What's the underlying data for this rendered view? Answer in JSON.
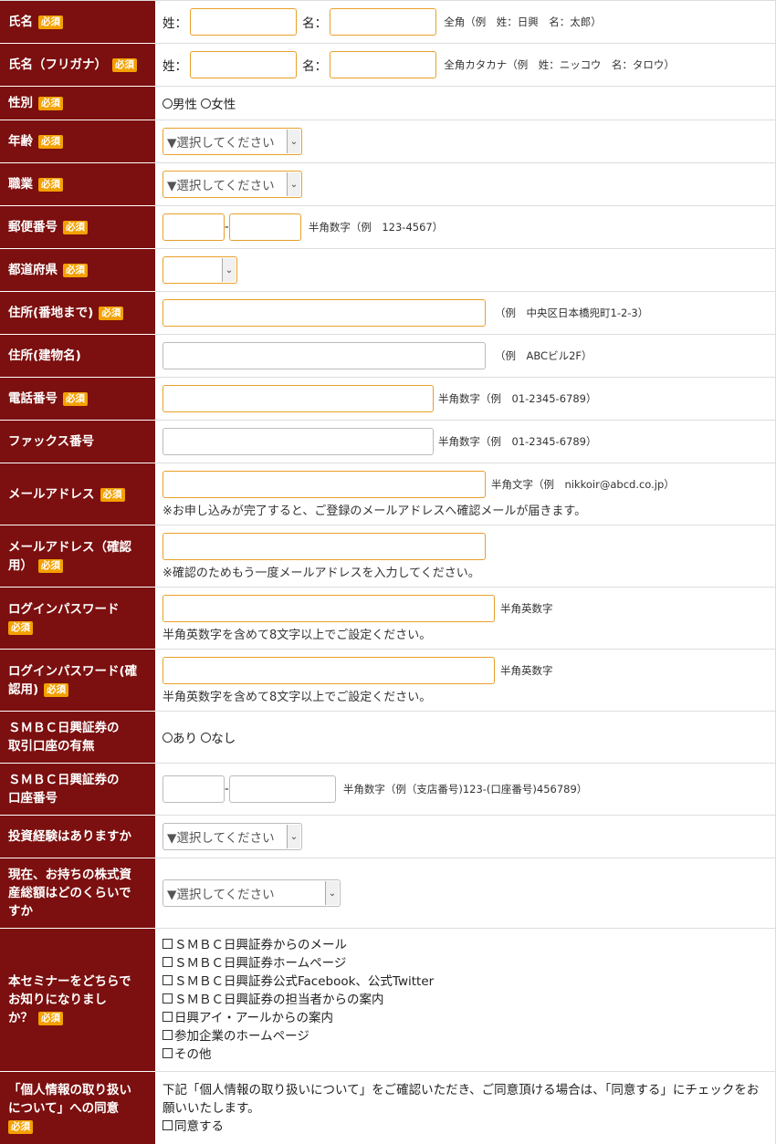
{
  "required_badge": "必須",
  "rows": {
    "name": {
      "label": "氏名",
      "sei": "姓：",
      "mei": "名：",
      "note": "全角（例　姓：日興　名：太郎）"
    },
    "kana": {
      "label": "氏名（フリガナ）",
      "sei": "姓：",
      "mei": "名：",
      "note": "全角カタカナ（例　姓：ニッコウ　名：タロウ）"
    },
    "gender": {
      "label": "性別",
      "options": [
        "男性",
        "女性"
      ]
    },
    "age": {
      "label": "年齢",
      "select": "▼選択してください"
    },
    "job": {
      "label": "職業",
      "select": "▼選択してください"
    },
    "zip": {
      "label": "郵便番号",
      "sep": "-",
      "note": "半角数字（例　123-4567）"
    },
    "pref": {
      "label": "都道府県",
      "select": ""
    },
    "addr1": {
      "label": "住所(番地まで)",
      "note": "（例　中央区日本橋兜町1-2-3）"
    },
    "addr2": {
      "label": "住所(建物名)",
      "note": "（例　ABCビル2F）"
    },
    "tel": {
      "label": "電話番号",
      "note": "半角数字（例　01-2345-6789）"
    },
    "fax": {
      "label": "ファックス番号",
      "note": "半角数字（例　01-2345-6789）"
    },
    "mail": {
      "label": "メールアドレス",
      "note": "半角文字（例　nikkoir@abcd.co.jp）",
      "sub": "※お申し込みが完了すると、ご登録のメールアドレスへ確認メールが届きます。"
    },
    "mail2": {
      "label_1": "メールアドレス（確認",
      "label_2": "用）",
      "sub": "※確認のためもう一度メールアドレスを入力してください。"
    },
    "pw": {
      "label": "ログインパスワード",
      "note": "半角英数字",
      "sub": "半角英数字を含めて8文字以上でご設定ください。"
    },
    "pw2": {
      "label_1": "ログインパスワード(確",
      "label_2": "認用)",
      "note": "半角英数字",
      "sub": "半角英数字を含めて8文字以上でご設定ください。"
    },
    "acct": {
      "label_1": "ＳＭＢＣ日興証券の",
      "label_2": "取引口座の有無",
      "options": [
        "あり",
        "なし"
      ]
    },
    "acctno": {
      "label_1": "ＳＭＢＣ日興証券の",
      "label_2": "口座番号",
      "sep": "-",
      "note": "半角数字（例（支店番号)123-(口座番号)456789）"
    },
    "exp": {
      "label": "投資経験はありますか",
      "select": "▼選択してください"
    },
    "assets": {
      "label_1": "現在、お持ちの株式資",
      "label_2": "産総額はどのくらいで",
      "label_3": "すか",
      "select": "▼選択してください"
    },
    "source": {
      "label_1": "本セミナーをどちらで",
      "label_2": "お知りになりまし",
      "label_3": "か？",
      "options": [
        "ＳＭＢＣ日興証券からのメール",
        "ＳＭＢＣ日興証券ホームページ",
        "ＳＭＢＣ日興証券公式Facebook、公式Twitter",
        "ＳＭＢＣ日興証券の担当者からの案内",
        "日興アイ・アールからの案内",
        "参加企業のホームページ",
        "その他"
      ]
    },
    "privacy": {
      "label_1": "「個人情報の取り扱い",
      "label_2": "について」への同意",
      "text": "下記「個人情報の取り扱いについて」をご確認いただき、ご同意頂ける場合は、「同意する」にチェックをお願いいたします。",
      "agree": "同意する"
    }
  }
}
